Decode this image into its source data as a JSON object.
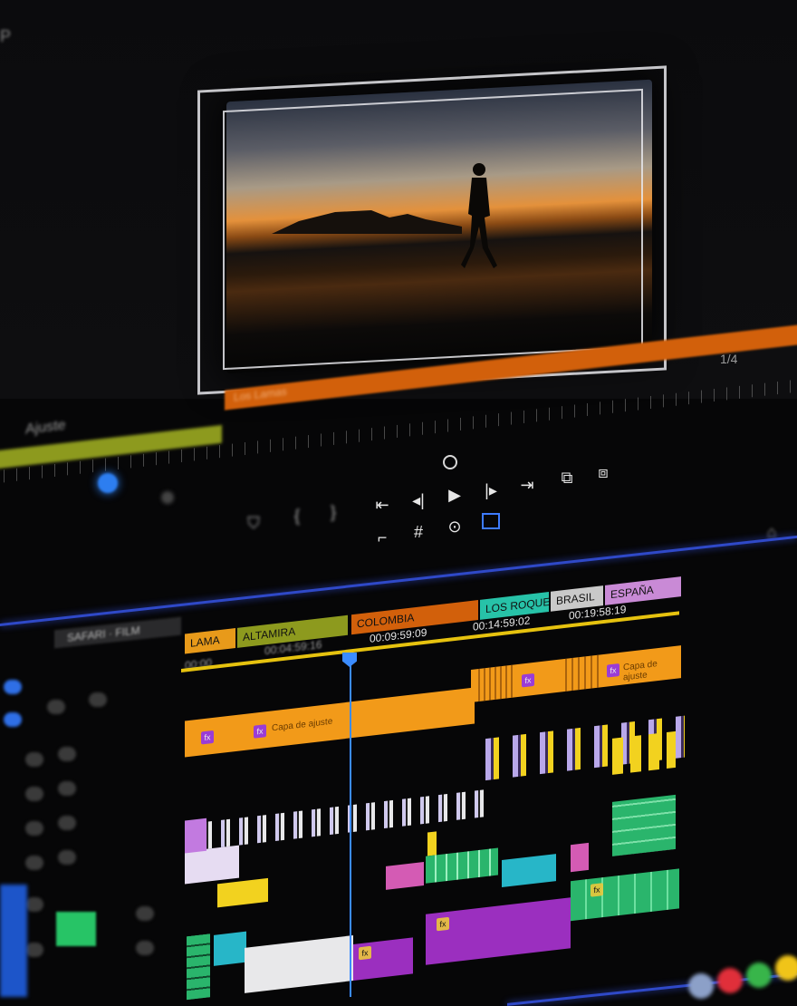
{
  "monitor": {
    "corner_label": "P",
    "right_label": "1/4",
    "scrub_left_label": "Ajuste",
    "scrub_orange_label": "Los Lamas"
  },
  "timeline": {
    "sequence_tab": "SAFARI · FILM",
    "markers": [
      {
        "label": "LAMA",
        "color": "#e89a1a"
      },
      {
        "label": "ALTAMIRA",
        "color": "#8d9a1e"
      },
      {
        "label": "COLOMBIA",
        "color": "#d2600b"
      },
      {
        "label": "LOS ROQUES",
        "color": "#27c2a8"
      },
      {
        "label": "BRASIL",
        "color": "#c9c9c9"
      },
      {
        "label": "ESPAÑA",
        "color": "#c98ad6"
      }
    ],
    "timecodes": [
      "00:00",
      "00:04:59:16",
      "00:09:59:09",
      "00:14:59:02",
      "00:19:58:19"
    ],
    "adjustment_label": "Capa de ajuste",
    "adjustment_label_2": "Capa de ajuste"
  },
  "colors": {
    "accent_blue": "#3b8cff",
    "orange": "#f29a19",
    "purple": "#9b2fbf",
    "green": "#2ab56c"
  },
  "icons": [
    "mark-in-icon",
    "mark-out-icon",
    "go-to-in-icon",
    "step-back-icon",
    "play-icon",
    "step-forward-icon",
    "go-to-out-icon",
    "lift-icon",
    "extract-icon",
    "insert-icon",
    "grid-icon",
    "camera-icon",
    "safe-margins-icon"
  ]
}
